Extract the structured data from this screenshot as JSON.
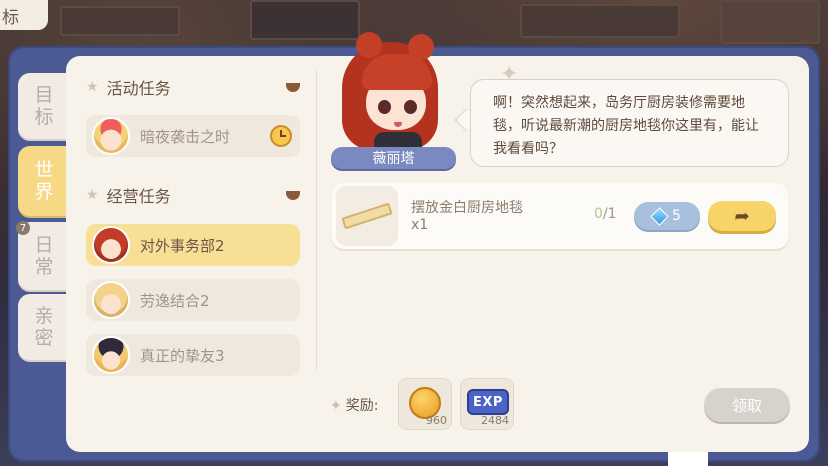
{
  "corner_label": "标",
  "tabs": [
    {
      "label": "目\n标",
      "active": false
    },
    {
      "label": "世\n界",
      "active": true
    },
    {
      "label": "日\n常",
      "active": false,
      "badge": "7"
    },
    {
      "label": "亲\n密",
      "active": false
    }
  ],
  "sections": {
    "activity": {
      "title": "活动任务",
      "tasks": [
        {
          "name": "暗夜袭击之时",
          "avatar": "knight-avatar",
          "icon": "clock-icon"
        }
      ]
    },
    "business": {
      "title": "经营任务",
      "tasks": [
        {
          "name": "对外事务部2",
          "avatar": "red-hair-avatar",
          "active": true
        },
        {
          "name": "劳逸结合2",
          "avatar": "blonde-avatar"
        },
        {
          "name": "真正的挚友3",
          "avatar": "witch-avatar"
        }
      ]
    }
  },
  "npc": {
    "name": "薇丽塔",
    "dialogue": "啊！突然想起来，岛务厅厨房装修需要地毯，听说最新潮的厨房地毯你这里有，能让我看看吗？"
  },
  "requirement": {
    "item_name": "摆放金白厨房地毯",
    "quantity": "x1",
    "progress_current": "0",
    "progress_total": "/1",
    "cost": "5",
    "cost_icon": "gem-icon",
    "go_icon": "arrow-right-icon"
  },
  "rewards": {
    "label": "奖励:",
    "items": [
      {
        "icon": "coin-icon",
        "amount": "960"
      },
      {
        "icon": "exp-icon",
        "text": "EXP",
        "amount": "2484"
      }
    ]
  },
  "claim_button": "领取",
  "colors": {
    "window": "#4b5a94",
    "panel": "#f7f2ea",
    "active_tab": "#f7d884",
    "active_task": "#f8df96",
    "name_tag": "#7a89bf",
    "go_button": "#f6d46a",
    "cost_button": "#a9c0dc"
  }
}
